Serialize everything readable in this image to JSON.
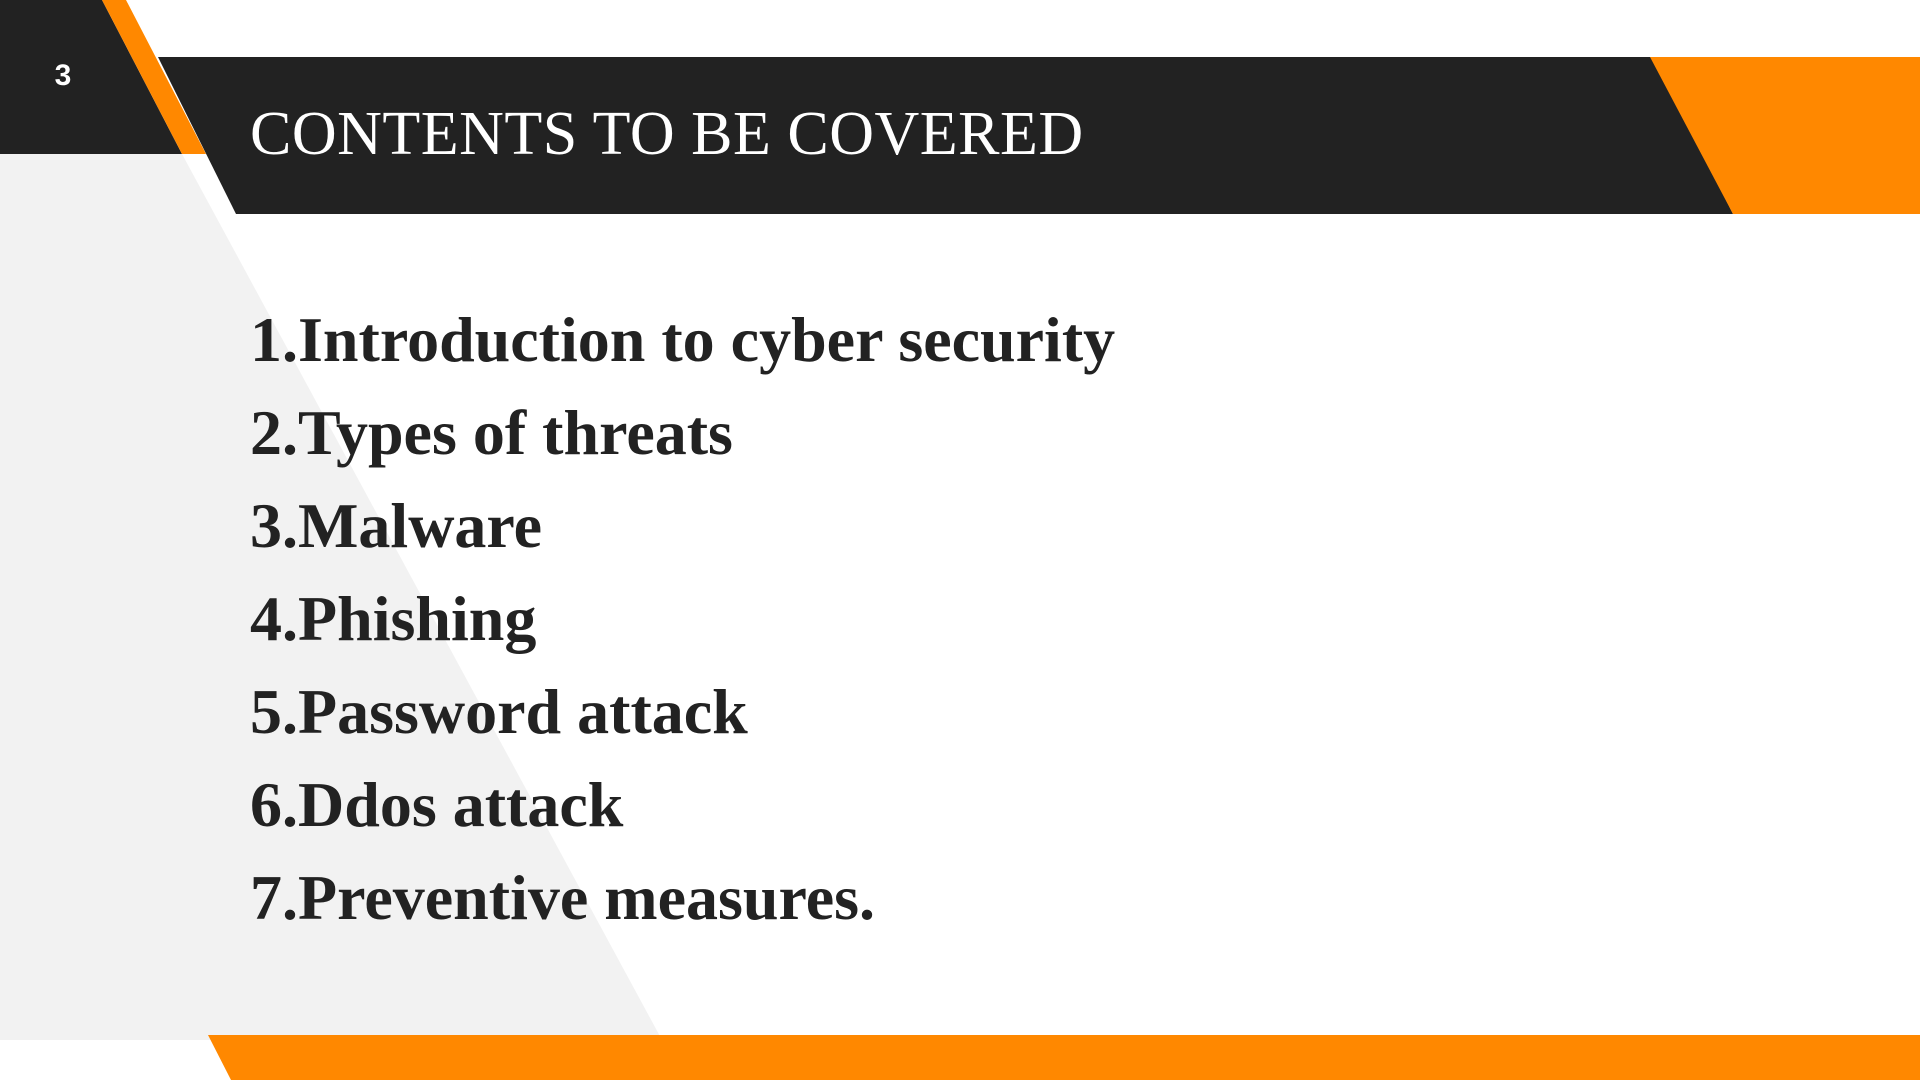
{
  "slide": {
    "number": "3",
    "title": "CONTENTS TO BE COVERED",
    "items": [
      "1.Introduction to cyber security",
      "2.Types of threats",
      "3.Malware",
      "4.Phishing",
      "5.Password attack",
      "6.Ddos attack",
      "7.Preventive measures."
    ]
  },
  "colors": {
    "header_dark": "#222222",
    "accent_orange": "#ff8800",
    "panel_gray": "#f2f2f2",
    "background": "#ffffff",
    "text": "#222222"
  }
}
